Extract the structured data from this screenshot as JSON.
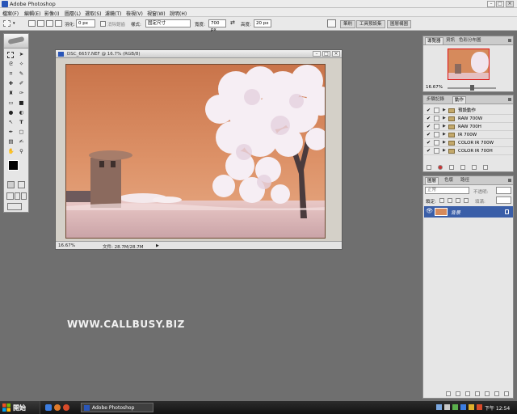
{
  "app_title": "Adobe Photoshop",
  "window_controls": {
    "minimize": "–",
    "maximize": "□",
    "close": "×"
  },
  "menu": [
    "檔案(F)",
    "編輯(E)",
    "影像(I)",
    "圖層(L)",
    "選取(S)",
    "濾鏡(T)",
    "檢視(V)",
    "視窗(W)",
    "說明(H)"
  ],
  "options_bar": {
    "feather_label": "羽化:",
    "feather_value": "0 px",
    "antialias_label": "消除鋸齒",
    "style_label": "樣式:",
    "style_value": "固定尺寸",
    "width_label": "寬度:",
    "width_value": "700 px",
    "swap_symbol": "⇄",
    "height_label": "高度:",
    "height_value": "20 px",
    "palette_tabs": [
      "筆刷",
      "工具預設集",
      "圖層構圖"
    ]
  },
  "document": {
    "title": "DSC_6657.NEF @ 16.7% (RGB/8)",
    "zoom": "16.67%",
    "doc_size": "文件: 28.7M/28.7M"
  },
  "navigator_panel": {
    "tabs": [
      "導覽器",
      "資訊",
      "色彩分布圖"
    ],
    "zoom": "16.67%"
  },
  "actions_panel": {
    "tabs": [
      "步驟記錄",
      "動作"
    ],
    "items": [
      {
        "label": "預設動作",
        "checked": true
      },
      {
        "label": "RAW 700W",
        "checked": true
      },
      {
        "label": "RAW 700H",
        "checked": true
      },
      {
        "label": "IR 700W",
        "checked": true
      },
      {
        "label": "COLOR IR 700W",
        "checked": true
      },
      {
        "label": "COLOR IR 700H",
        "checked": true
      }
    ],
    "check_symbol": "✔",
    "expand_symbol": "▶"
  },
  "layers_panel": {
    "tabs": [
      "圖層",
      "色版",
      "路徑"
    ],
    "blend_mode": "正常",
    "opacity_label": "不透明:",
    "lock_label": "鎖定:",
    "fill_label": "填滿:",
    "layer_name": "背景"
  },
  "watermark": "WWW.CALLBUSY.BIZ",
  "taskbar": {
    "start_label": "開始",
    "task_label": "Adobe Photoshop",
    "clock": "下午 12:54"
  },
  "colors": {
    "accent": "#2a56b8",
    "image_sky": "#d68a5c",
    "workspace": "#6f6f6f"
  }
}
